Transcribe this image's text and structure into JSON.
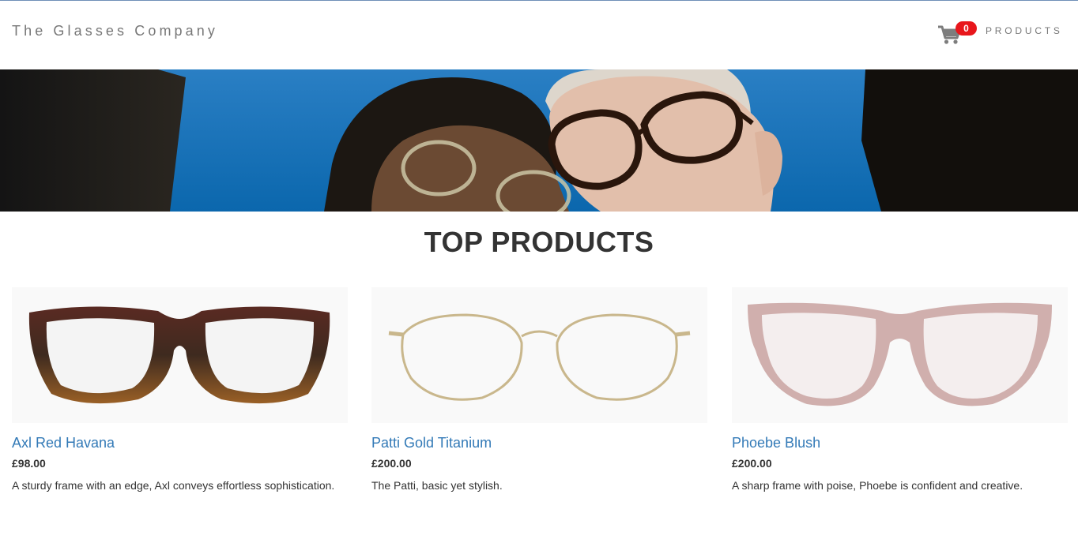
{
  "navbar": {
    "brand": "The Glasses Company",
    "cart_count": "0",
    "products_link": "PRODUCTS"
  },
  "main": {
    "title": "TOP PRODUCTS",
    "products": [
      {
        "name": "Axl Red Havana",
        "price": "£98.00",
        "description": "A sturdy frame with an edge, Axl conveys effortless sophistication."
      },
      {
        "name": "Patti Gold Titanium",
        "price": "£200.00",
        "description": "The Patti, basic yet stylish."
      },
      {
        "name": "Phoebe Blush",
        "price": "£200.00",
        "description": "A sharp frame with poise, Phoebe is confident and creative."
      }
    ]
  },
  "colors": {
    "link": "#337ab7",
    "badge": "#e8161b",
    "hero_sky": "#0d6fb5"
  },
  "icons": {
    "cart": "shopping-cart-icon"
  }
}
